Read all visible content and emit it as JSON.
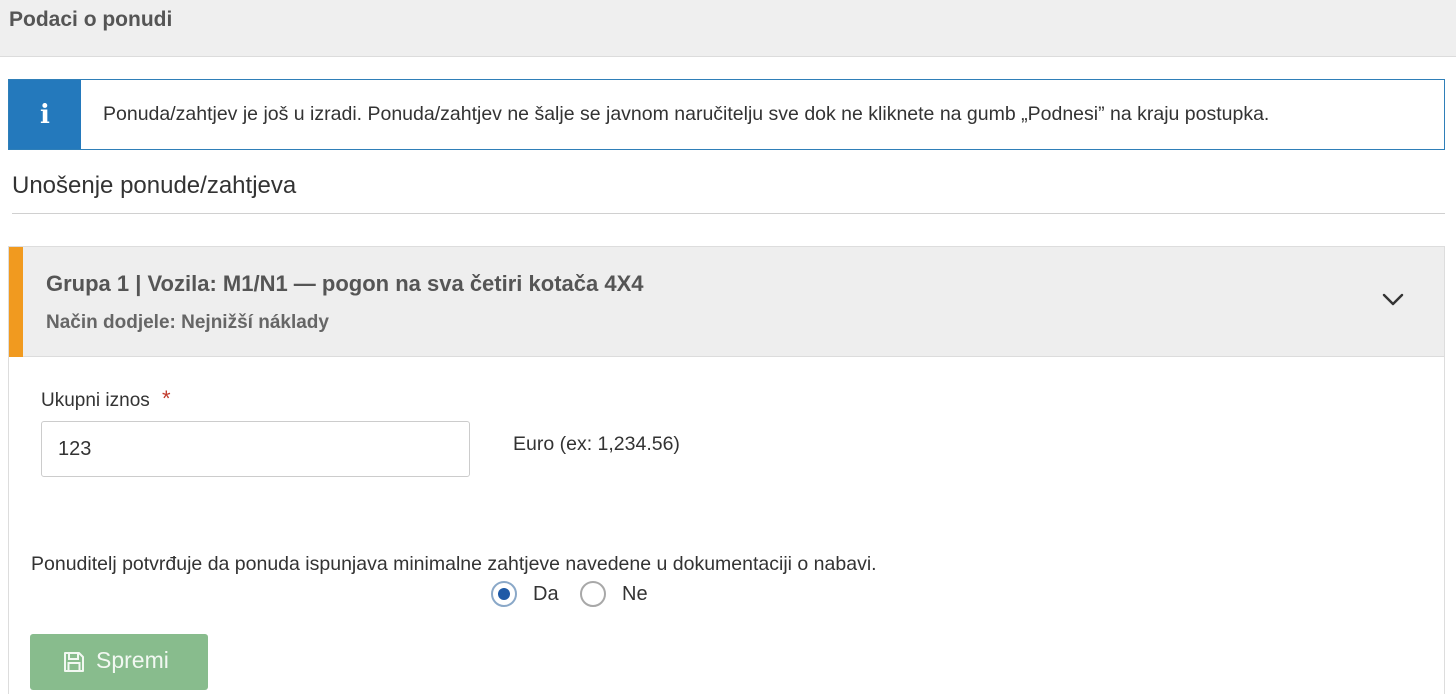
{
  "header": {
    "title": "Podaci o ponudi"
  },
  "info_alert": {
    "icon": "info-icon",
    "icon_glyph": "i",
    "message": "Ponuda/zahtjev je još u izradi. Ponuda/zahtjev ne šalje se javnom naručitelju sve dok ne kliknete na gumb „Podnesi” na kraju postupka.",
    "accent_color": "#2479bc"
  },
  "section": {
    "heading": "Unošenje ponude/zahtjeva"
  },
  "group": {
    "title": "Grupa 1 | Vozila: M1/N1 — pogon na sva četiri kotača 4X4",
    "subtitle": "Način dodjele: Nejnižší náklady",
    "accent_color": "#f19a1f",
    "toggle_icon": "chevron-down-icon",
    "form": {
      "amount_label": "Ukupni iznos",
      "required_marker": "*",
      "amount_value": "123",
      "currency_hint": "Euro (ex: 1,234.56)",
      "confirmation_text": "Ponuditelj potvrđuje da ponuda ispunjava minimalne zahtjeve navedene u dokumentaciji o nabavi.",
      "options": [
        {
          "label": "Da",
          "selected": true
        },
        {
          "label": "Ne",
          "selected": false
        }
      ],
      "save_button": {
        "label": "Spremi",
        "icon": "floppy-disk-icon",
        "color": "#88bc8d"
      }
    }
  }
}
